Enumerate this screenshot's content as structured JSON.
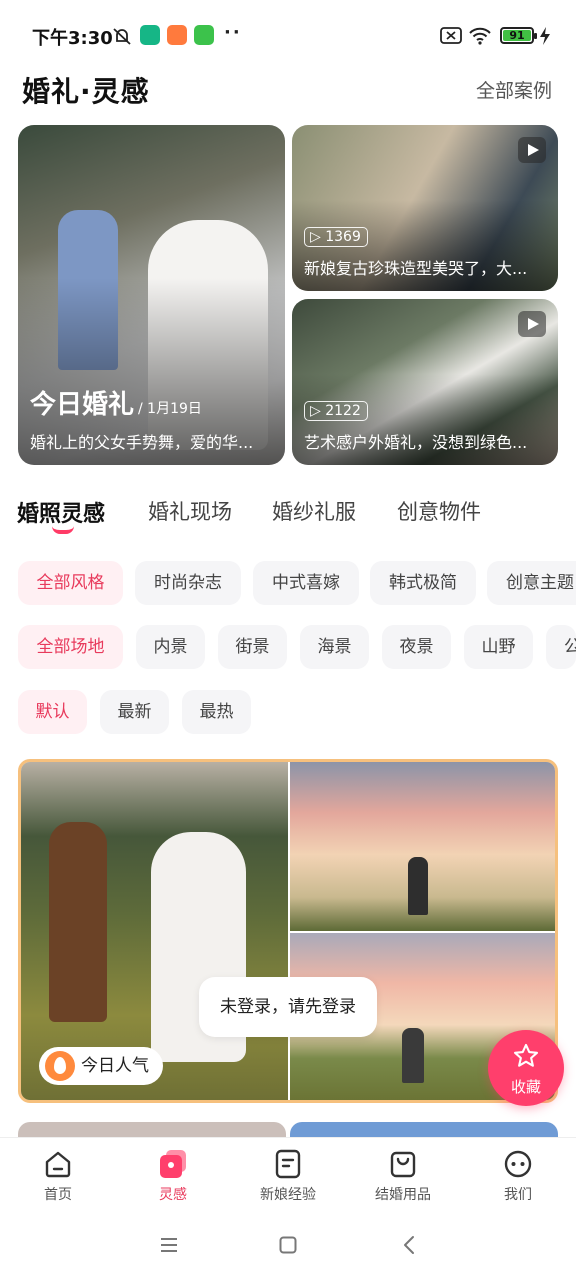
{
  "status_bar": {
    "time": "下午3:30",
    "battery": "91"
  },
  "header": {
    "title": "婚礼·灵感",
    "all_cases": "全部案例"
  },
  "featured": {
    "main": {
      "title": "今日婚礼",
      "date": "/ 1月19日",
      "caption": "婚礼上的父女手势舞，爱的华..."
    },
    "top_right": {
      "views": "1369",
      "caption": "新娘复古珍珠造型美哭了，大..."
    },
    "bottom_right": {
      "views": "2122",
      "caption": "艺术感户外婚礼，没想到绿色..."
    }
  },
  "tabs": [
    "婚照灵感",
    "婚礼现场",
    "婚纱礼服",
    "创意物件"
  ],
  "style_filters": [
    "全部风格",
    "时尚杂志",
    "中式喜嫁",
    "韩式极简",
    "创意主题"
  ],
  "venue_filters": [
    "全部场地",
    "内景",
    "街景",
    "海景",
    "夜景",
    "山野",
    "公"
  ],
  "sort_filters": [
    "默认",
    "最新",
    "最热"
  ],
  "gallery": {
    "badge": "今日人气"
  },
  "toast": "未登录，请先登录",
  "favorite_label": "收藏",
  "bottom_nav": [
    {
      "label": "首页",
      "icon": "home-icon"
    },
    {
      "label": "灵感",
      "icon": "inspiration-icon"
    },
    {
      "label": "新娘经验",
      "icon": "notes-icon"
    },
    {
      "label": "结婚用品",
      "icon": "shopping-bag-icon"
    },
    {
      "label": "我们",
      "icon": "couple-face-icon"
    }
  ],
  "colors": {
    "accent": "#ff3f6c",
    "accent_text": "#e83a5c",
    "gallery_border": "#f6c07d"
  }
}
